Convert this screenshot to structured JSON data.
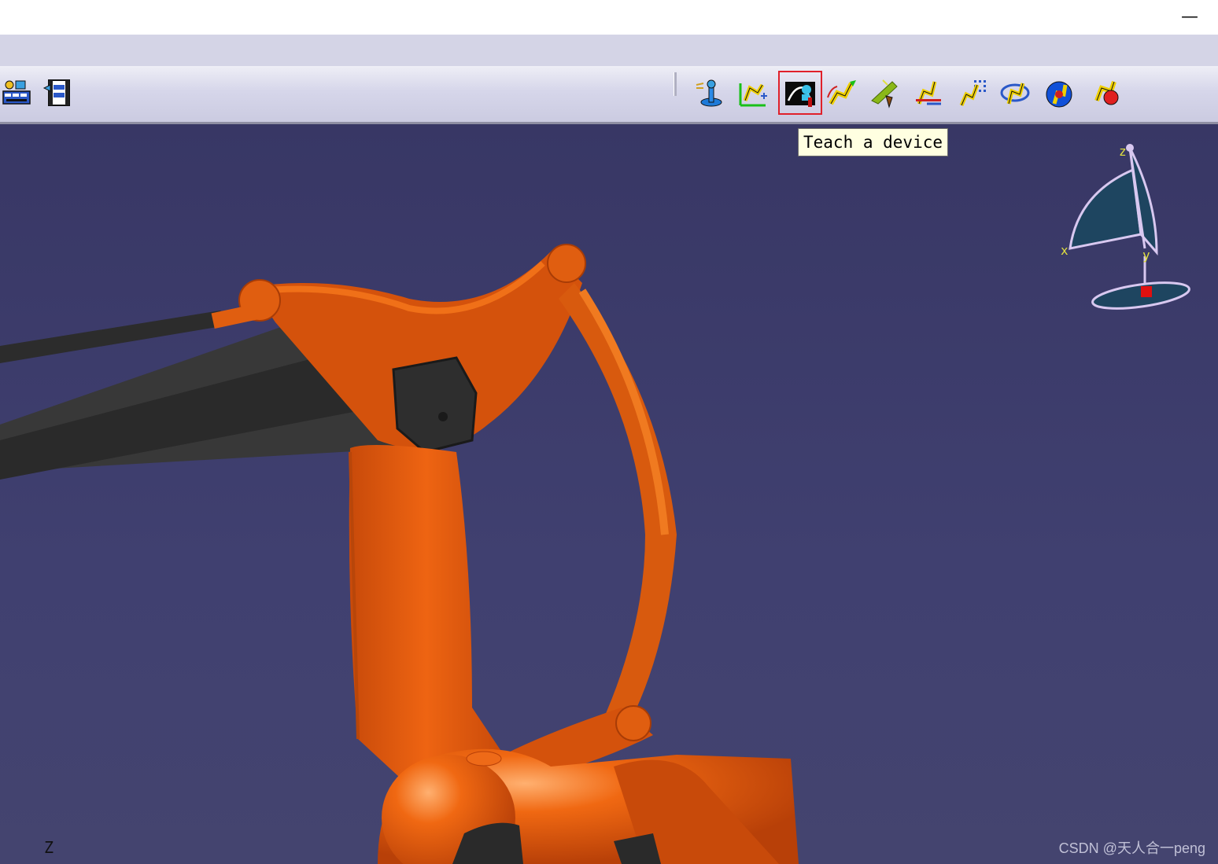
{
  "window": {
    "minimize_glyph": "—"
  },
  "toolbar": {
    "left_icons": [
      "simulation-icon",
      "film-clapboard-icon"
    ],
    "tools": [
      {
        "name": "joystick-tool-icon",
        "tooltip": ""
      },
      {
        "name": "jog-device-icon",
        "tooltip": ""
      },
      {
        "name": "teach-device-icon",
        "tooltip": "Teach a device",
        "active": true
      },
      {
        "name": "robot-motion-icon",
        "tooltip": ""
      },
      {
        "name": "tool-tip-icon",
        "tooltip": ""
      },
      {
        "name": "robot-wrench-icon",
        "tooltip": ""
      },
      {
        "name": "robot-grid-icon",
        "tooltip": ""
      },
      {
        "name": "robot-rotate-icon",
        "tooltip": ""
      },
      {
        "name": "robot-blue-circle-icon",
        "tooltip": ""
      },
      {
        "name": "robot-red-icon",
        "tooltip": ""
      }
    ]
  },
  "tooltip": {
    "text": "Teach a device"
  },
  "compass": {
    "labels": {
      "z": "z",
      "x": "x",
      "y": "y"
    }
  },
  "viewport": {
    "corner_axis_label": "Z"
  },
  "colors": {
    "viewport_bg": "#3c3b6b",
    "robot_orange": "#e85a0c",
    "robot_dark": "#3a3a3a",
    "highlight_red": "#e0202a",
    "tooltip_bg": "#ffffe1"
  },
  "watermark": {
    "text": "CSDN @天人合一peng"
  }
}
